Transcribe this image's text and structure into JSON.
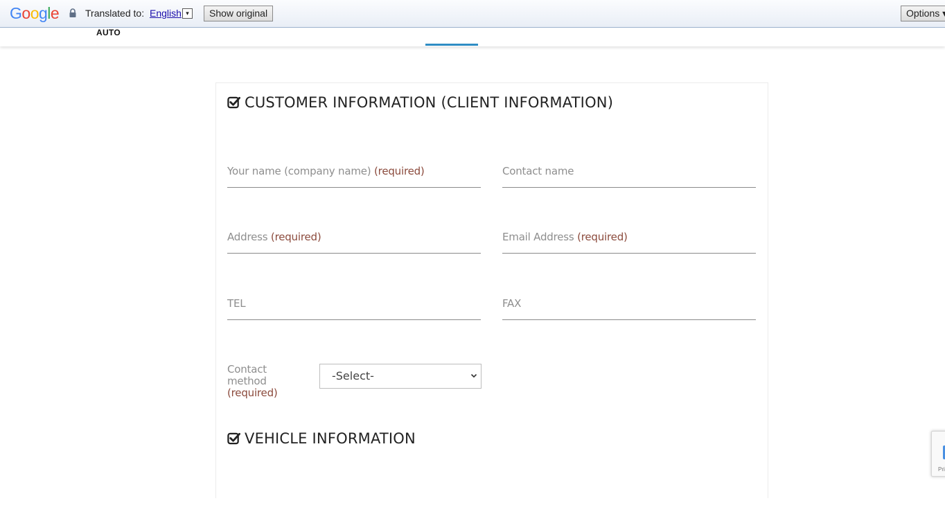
{
  "translate_bar": {
    "logo_letters": [
      "G",
      "o",
      "o",
      "g",
      "l",
      "e"
    ],
    "logo_colors": [
      "#4285f4",
      "#ea4335",
      "#fbbc05",
      "#4285f4",
      "#34a853",
      "#ea4335"
    ],
    "translated_to_label": "Translated to:",
    "language": "English",
    "language_dropdown_glyph": "▾",
    "show_original_label": "Show original",
    "options_label": "Options ▾",
    "lock_icon": "lock-icon"
  },
  "site_header": {
    "brand_text": "AUTO"
  },
  "customer_section": {
    "title": "CUSTOMER INFORMATION (CLIENT INFORMATION)",
    "icon": "checkbox-checked-icon",
    "fields": {
      "name": {
        "label": "Your name (company name)",
        "required": "(required)"
      },
      "contact_name": {
        "label": "Contact name"
      },
      "address": {
        "label": "Address",
        "required": "(required)"
      },
      "email": {
        "label": "Email Address",
        "required": "(required)"
      },
      "tel": {
        "label": "TEL"
      },
      "fax": {
        "label": "FAX"
      }
    },
    "contact_method": {
      "label_line1": "Contact",
      "label_line2": "method",
      "required": "(required)",
      "select_value": "-Select-"
    }
  },
  "vehicle_section": {
    "title": "VEHICLE INFORMATION",
    "icon": "checkbox-checked-icon"
  },
  "recaptcha": {
    "text": "Pri"
  },
  "colors": {
    "required_text": "#8b4a3c",
    "label_gray": "#8e8e8e",
    "nav_active": "#2f8dc4",
    "link_blue": "#1a0dab"
  }
}
